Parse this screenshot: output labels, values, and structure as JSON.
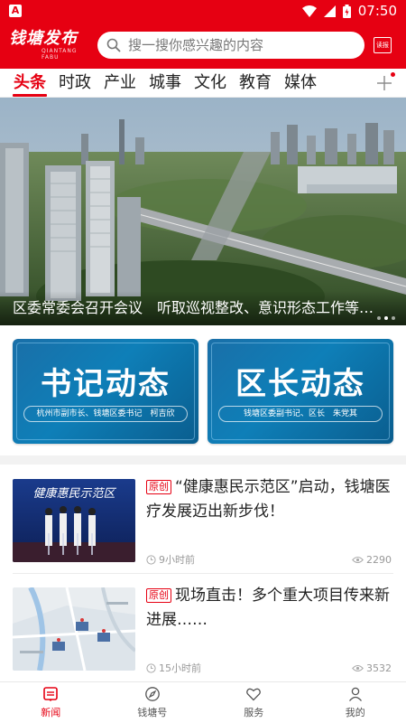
{
  "status_bar": {
    "app_badge": "A",
    "time": "07:50"
  },
  "header": {
    "logo_text": "钱塘发布",
    "logo_sub": "QIANTANG FABU",
    "search_placeholder": "搜一搜你感兴趣的内容",
    "paper_label": "读报"
  },
  "tabs": [
    {
      "label": "头条",
      "active": true
    },
    {
      "label": "时政",
      "active": false
    },
    {
      "label": "产业",
      "active": false
    },
    {
      "label": "城事",
      "active": false
    },
    {
      "label": "文化",
      "active": false
    },
    {
      "label": "教育",
      "active": false
    },
    {
      "label": "媒体",
      "active": false
    }
  ],
  "banner": {
    "caption": "区委常委会召开会议　听取巡视整改、意识形态工作等情况汇报",
    "slide_count": 3,
    "active_slide": 2
  },
  "cards": [
    {
      "title": "书记动态",
      "subtitle": "杭州市副市长、钱塘区委书记　柯吉欣"
    },
    {
      "title": "区长动态",
      "subtitle": "钱塘区委副书记、区长　朱党其"
    }
  ],
  "news": [
    {
      "tag": "原创",
      "title": "“健康惠民示范区”启动，钱塘医疗发展迈出新步伐！",
      "thumb_text": "健康惠民示范区",
      "time": "9小时前",
      "views": "2290"
    },
    {
      "tag": "原创",
      "title": "现场直击！多个重大项目传来新进展……",
      "time": "15小时前",
      "views": "3532"
    }
  ],
  "bottom_nav": [
    {
      "label": "新闻",
      "icon": "news-icon",
      "active": true
    },
    {
      "label": "钱塘号",
      "icon": "compass-icon",
      "active": false
    },
    {
      "label": "服务",
      "icon": "heart-icon",
      "active": false
    },
    {
      "label": "我的",
      "icon": "person-icon",
      "active": false
    }
  ],
  "colors": {
    "brand_red": "#e60012",
    "card_blue": "#0e7fb8"
  }
}
